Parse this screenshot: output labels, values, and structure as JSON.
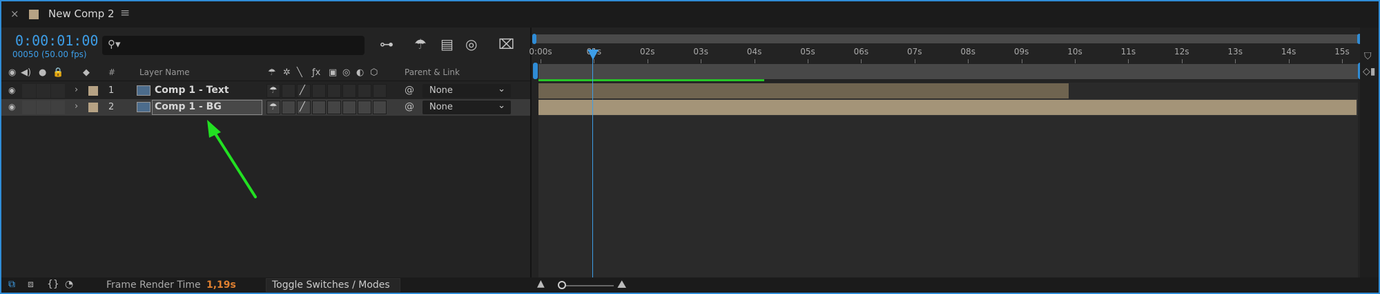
{
  "tab": {
    "title": "New Comp 2",
    "close_glyph": "×",
    "menu_glyph": "≡"
  },
  "header": {
    "timecode": "0:00:01:00",
    "frames": "00050 (50.00 fps)",
    "search_placeholder": ""
  },
  "columns": {
    "num": "#",
    "layer_name": "Layer Name",
    "parent_link": "Parent & Link"
  },
  "layers": [
    {
      "num": "1",
      "name": "Comp 1 - Text",
      "parent": "None",
      "selected": false
    },
    {
      "num": "2",
      "name": "Comp 1 - BG",
      "parent": "None",
      "selected": true
    }
  ],
  "ruler": {
    "ticks": [
      "0:00s",
      "01s",
      "02s",
      "03s",
      "04s",
      "05s",
      "06s",
      "07s",
      "08s",
      "09s",
      "10s",
      "11s",
      "12s",
      "13s",
      "14s",
      "15s"
    ]
  },
  "footer": {
    "frame_render_label": "Frame Render Time",
    "frame_render_value": "1,19s",
    "toggle_label": "Toggle Switches / Modes"
  },
  "colors": {
    "accent": "#3d9ee8",
    "label": "#b6a284",
    "cache": "#27c627",
    "annotation": "#22e022"
  }
}
